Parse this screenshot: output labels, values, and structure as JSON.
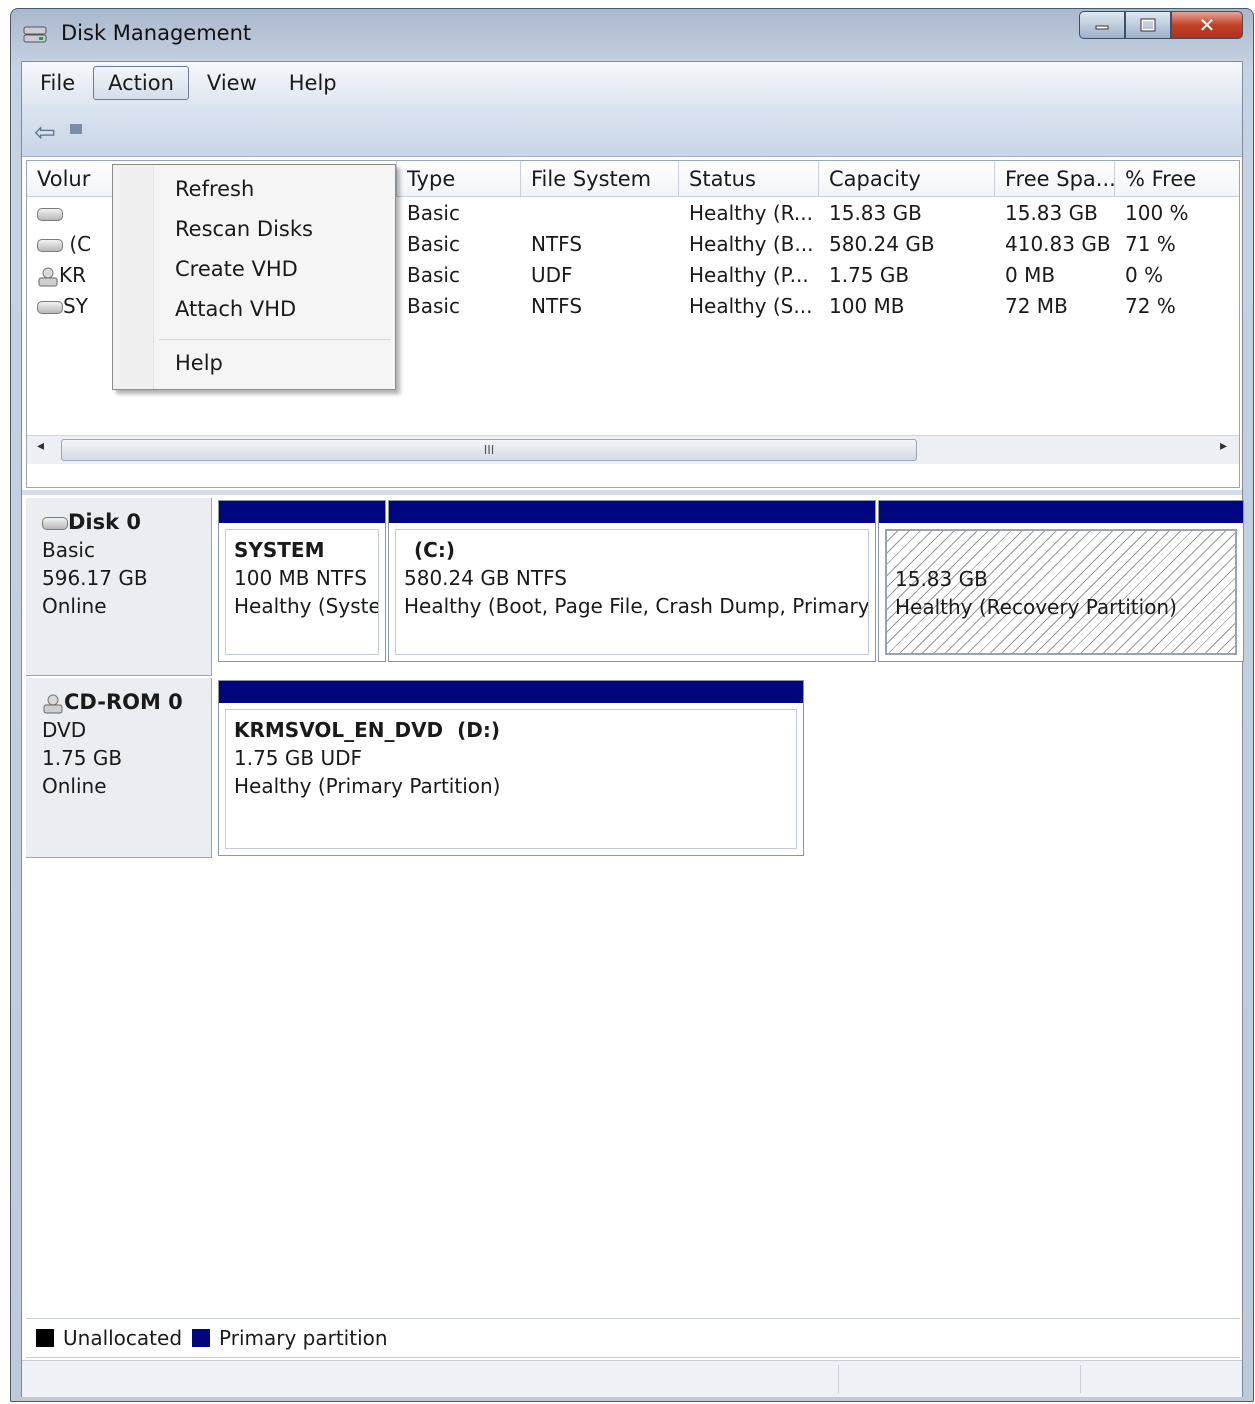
{
  "window": {
    "title": "Disk Management"
  },
  "menubar": {
    "file": "File",
    "action": "Action",
    "view": "View",
    "help": "Help"
  },
  "context_menu": {
    "refresh": "Refresh",
    "rescan": "Rescan Disks",
    "create_vhd": "Create VHD",
    "attach_vhd": "Attach VHD",
    "help": "Help"
  },
  "volume_list": {
    "headers": [
      "Volur",
      "Type",
      "File System",
      "Status",
      "Capacity",
      "Free Spa...",
      "% Free"
    ],
    "rows": [
      {
        "volume": "",
        "type": "Basic",
        "fs": "",
        "status": "Healthy (R...",
        "capacity": "15.83 GB",
        "free": "15.83 GB",
        "pct": "100 %",
        "icon": "drive-icon"
      },
      {
        "volume": "(C",
        "type": "Basic",
        "fs": "NTFS",
        "status": "Healthy (B...",
        "capacity": "580.24 GB",
        "free": "410.83 GB",
        "pct": "71 %",
        "icon": "drive-icon"
      },
      {
        "volume": "KR",
        "type": "Basic",
        "fs": "UDF",
        "status": "Healthy (P...",
        "capacity": "1.75 GB",
        "free": "0 MB",
        "pct": "0 %",
        "icon": "cd-drive-icon"
      },
      {
        "volume": "SY",
        "type": "Basic",
        "fs": "NTFS",
        "status": "Healthy (S...",
        "capacity": "100 MB",
        "free": "72 MB",
        "pct": "72 %",
        "icon": "drive-icon"
      }
    ],
    "scroll_thumb": "III"
  },
  "disks": [
    {
      "name": "Disk 0",
      "type": "Basic",
      "size": "596.17 GB",
      "state": "Online"
    },
    {
      "name": "CD-ROM 0",
      "type": "DVD",
      "size": "1.75 GB",
      "state": "Online"
    }
  ],
  "partitions": {
    "system": {
      "name": "SYSTEM",
      "detail": "100 MB NTFS",
      "status": "Healthy (Systei"
    },
    "c": {
      "name": "(C:)",
      "detail": "580.24 GB NTFS",
      "status": "Healthy (Boot, Page File, Crash Dump, Primary F"
    },
    "recovery": {
      "detail": "15.83 GB",
      "status": "Healthy (Recovery Partition)"
    },
    "dvd": {
      "name": "KRMSVOL_EN_DVD  (D:)",
      "detail": "1.75 GB UDF",
      "status": "Healthy (Primary Partition)"
    }
  },
  "legend": {
    "unallocated": "Unallocated",
    "primary": "Primary partition",
    "unallocated_color": "#000000",
    "primary_color": "#00067e"
  }
}
